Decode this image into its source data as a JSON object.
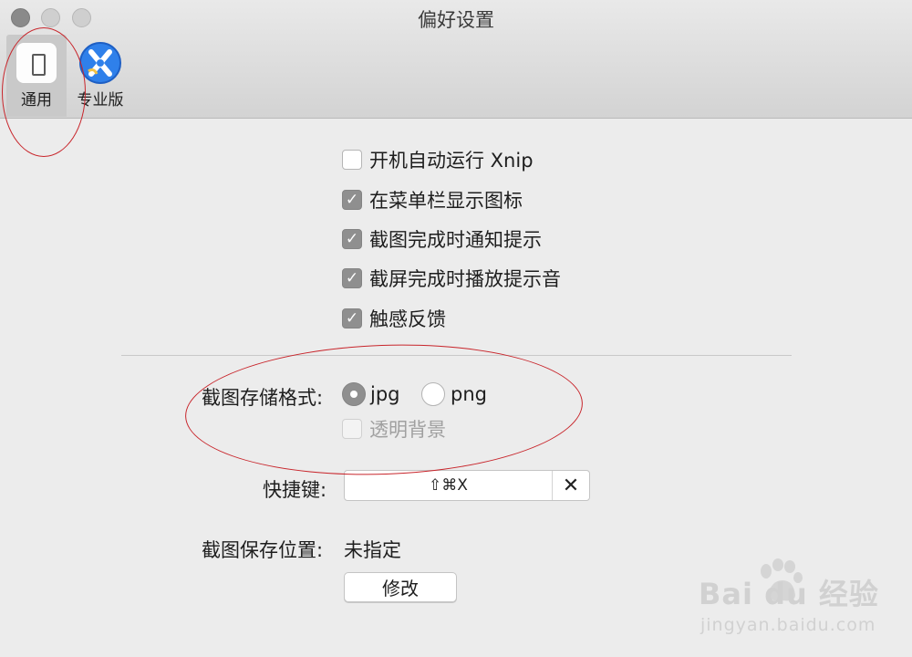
{
  "window": {
    "title": "偏好设置"
  },
  "toolbar": {
    "items": [
      {
        "label": "通用",
        "icon": "switch-icon",
        "selected": true
      },
      {
        "label": "专业版",
        "icon": "xnip-logo-icon",
        "selected": false
      }
    ]
  },
  "general": {
    "options": [
      {
        "label": "开机自动运行 Xnip",
        "checked": false
      },
      {
        "label": "在菜单栏显示图标",
        "checked": true
      },
      {
        "label": "截图完成时通知提示",
        "checked": true
      },
      {
        "label": "截屏完成时播放提示音",
        "checked": true
      },
      {
        "label": "触感反馈",
        "checked": true
      }
    ],
    "format": {
      "label": "截图存储格式:",
      "options": [
        {
          "label": "jpg",
          "selected": true
        },
        {
          "label": "png",
          "selected": false
        }
      ],
      "transparent_label": "透明背景",
      "transparent_enabled": false
    },
    "shortcut": {
      "label": "快捷键:",
      "value": "⇧⌘X",
      "clear_glyph": "✕"
    },
    "save_location": {
      "label": "截图保存位置:",
      "value": "未指定",
      "button_label": "修改"
    }
  },
  "watermark": {
    "brand": "Bai du 经验",
    "url": "jingyan.baidu.com"
  },
  "colors": {
    "annotation": "#c8252b",
    "check_fill": "#8f8f8f"
  }
}
